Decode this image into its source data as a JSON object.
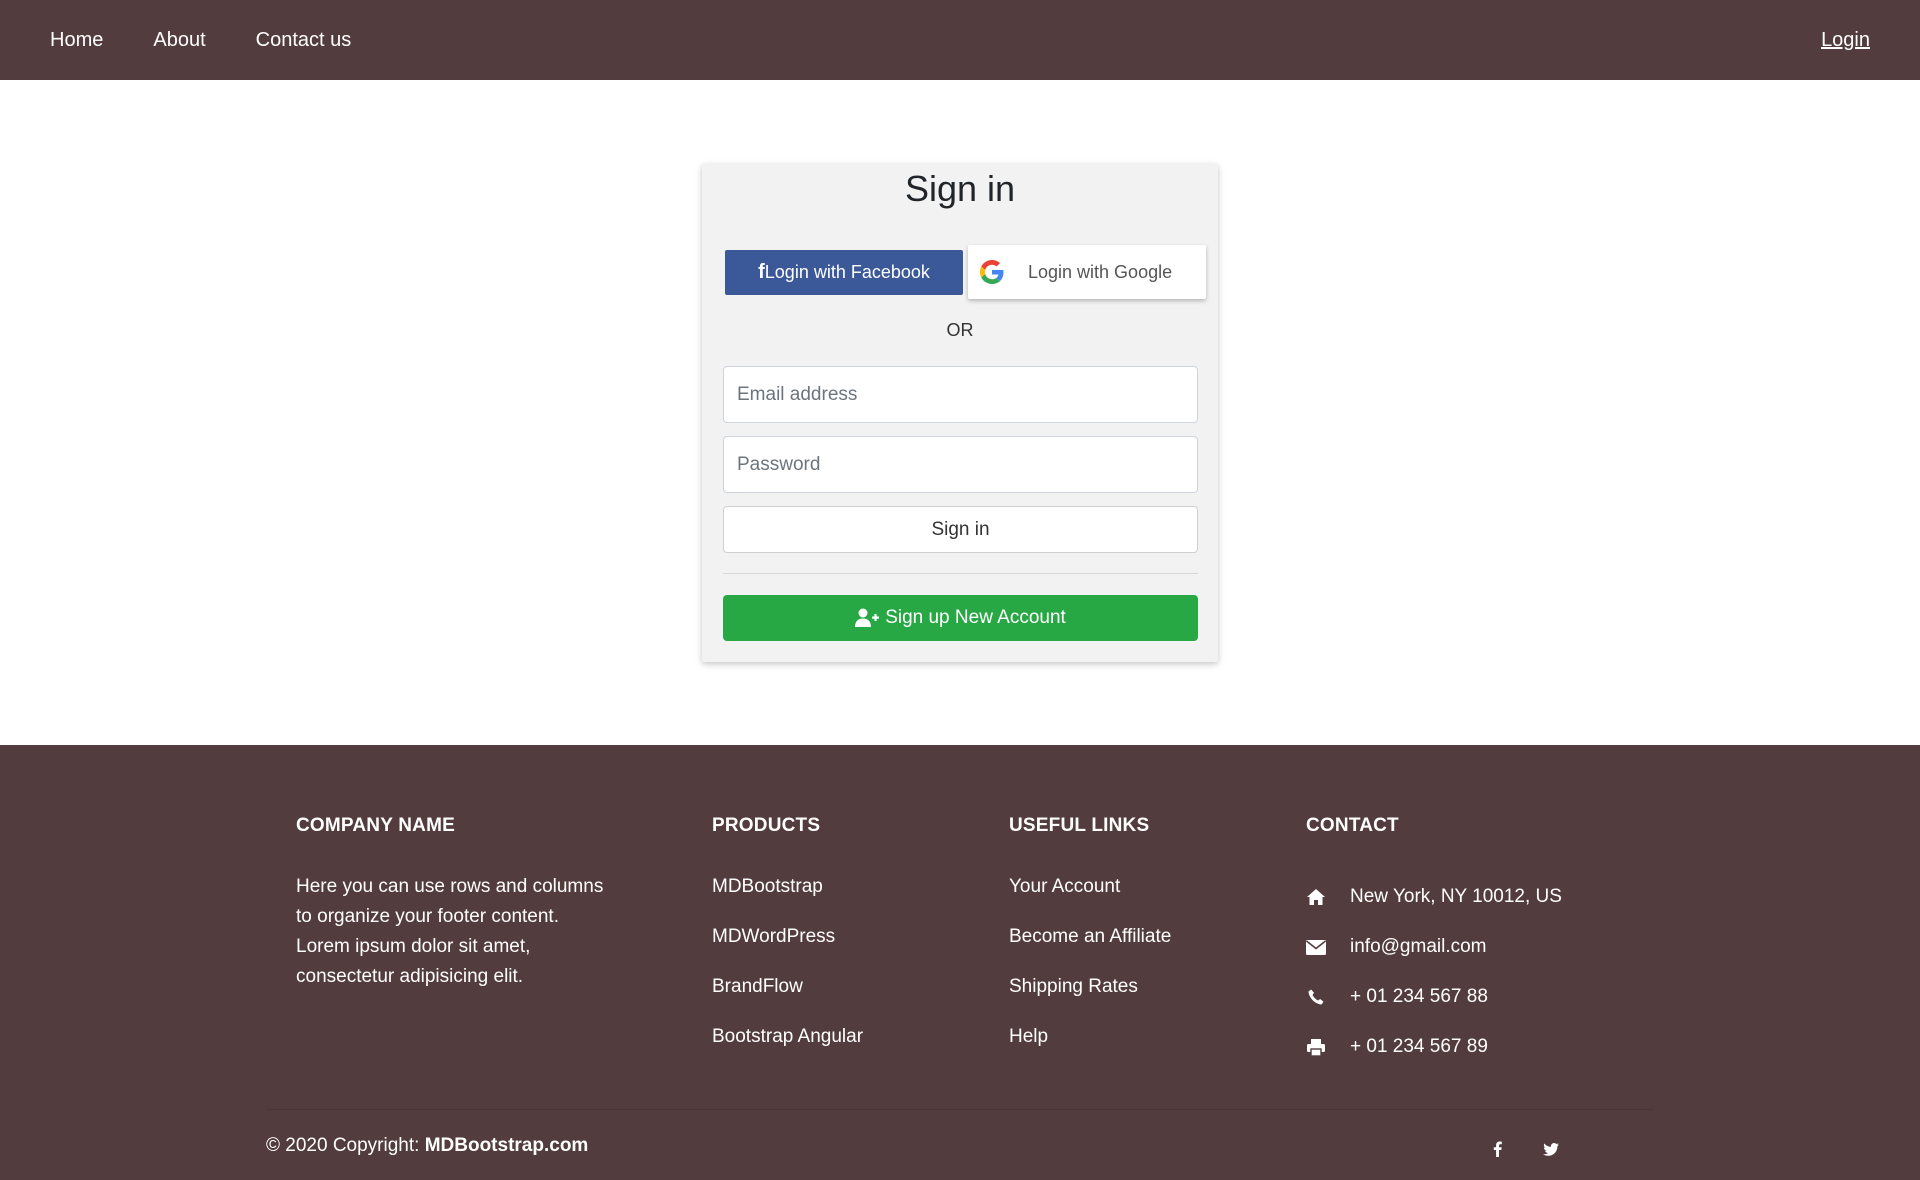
{
  "navbar": {
    "items": [
      {
        "label": "Home"
      },
      {
        "label": "About"
      },
      {
        "label": "Contact us"
      }
    ],
    "login_label": "Login",
    "background": "#533c3d"
  },
  "signin_card": {
    "title": "Sign in",
    "facebook_button": {
      "glyph": "f",
      "label": "Login with Facebook",
      "color": "#3b5998"
    },
    "google_button": {
      "label": "Login with Google"
    },
    "or_text": "OR",
    "email_placeholder": "Email address",
    "password_placeholder": "Password",
    "signin_button": "Sign in",
    "signup_button": "Sign up New Account",
    "signup_color": "#28a745"
  },
  "footer": {
    "company": {
      "heading": "COMPANY NAME",
      "lines": [
        "Here you can use rows and columns",
        "to organize your footer content.",
        "Lorem ipsum dolor sit amet,",
        "consectetur adipisicing elit."
      ]
    },
    "products": {
      "heading": "PRODUCTS",
      "items": [
        "MDBootstrap",
        "MDWordPress",
        "BrandFlow",
        "Bootstrap Angular"
      ]
    },
    "useful_links": {
      "heading": "USEFUL LINKS",
      "items": [
        "Your Account",
        "Become an Affiliate",
        "Shipping Rates",
        "Help"
      ]
    },
    "contact": {
      "heading": "CONTACT",
      "items": [
        {
          "icon": "home-icon",
          "text": "New York, NY 10012, US"
        },
        {
          "icon": "envelope-icon",
          "text": "info@gmail.com"
        },
        {
          "icon": "phone-icon",
          "text": "+ 01 234 567 88"
        },
        {
          "icon": "print-icon",
          "text": "+ 01 234 567 89"
        }
      ]
    },
    "copyright_prefix": "© 2020 Copyright: ",
    "copyright_link": "MDBootstrap.com",
    "social": [
      "facebook-icon",
      "twitter-icon"
    ]
  }
}
